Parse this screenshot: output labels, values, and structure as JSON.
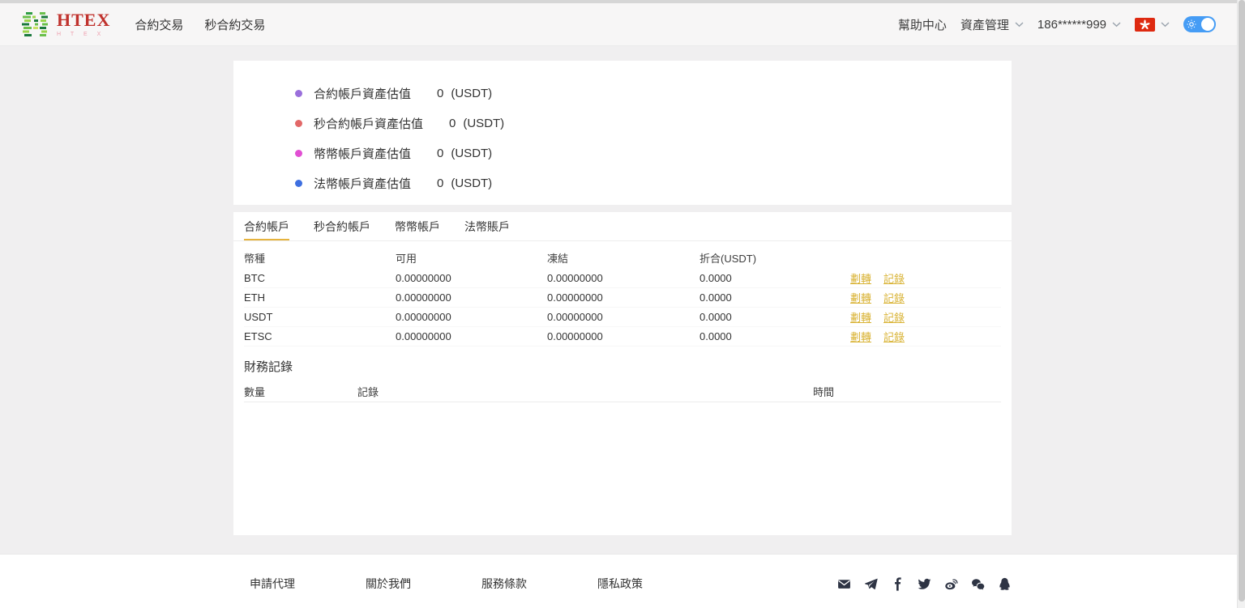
{
  "header": {
    "logo": {
      "title": "HTEX",
      "subtitle": "H T E X"
    },
    "nav": [
      {
        "id": "contract-trading",
        "label": "合約交易"
      },
      {
        "id": "second-contract-trading",
        "label": "秒合約交易"
      }
    ],
    "help_center": "幫助中心",
    "asset_management": "資產管理",
    "account": "186******999",
    "language_flag": "hong-kong",
    "theme_toggle_on": true
  },
  "summary": {
    "items": [
      {
        "label": "合約帳戶資產估值",
        "value": "0",
        "unit": "(USDT)",
        "dot_color": "#9a6fdb"
      },
      {
        "label": "秒合約帳戶資產估值",
        "value": "0",
        "unit": "(USDT)",
        "dot_color": "#e26868"
      },
      {
        "label": "幣幣帳戶資產估值",
        "value": "0",
        "unit": "(USDT)",
        "dot_color": "#e14fd3"
      },
      {
        "label": "法幣帳戶資產估值",
        "value": "0",
        "unit": "(USDT)",
        "dot_color": "#3e6fe0"
      }
    ]
  },
  "accounts": {
    "tabs": [
      {
        "id": "contract",
        "label": "合約帳戶",
        "active": true
      },
      {
        "id": "second-contract",
        "label": "秒合約帳戶",
        "active": false
      },
      {
        "id": "spot",
        "label": "幣幣帳戶",
        "active": false
      },
      {
        "id": "fiat",
        "label": "法幣賬戶",
        "active": false
      }
    ],
    "table": {
      "headers": [
        "幣種",
        "可用",
        "凍結",
        "折合(USDT)"
      ],
      "rows": [
        {
          "coin": "BTC",
          "available": "0.00000000",
          "frozen": "0.00000000",
          "converted": "0.0000"
        },
        {
          "coin": "ETH",
          "available": "0.00000000",
          "frozen": "0.00000000",
          "converted": "0.0000"
        },
        {
          "coin": "USDT",
          "available": "0.00000000",
          "frozen": "0.00000000",
          "converted": "0.0000"
        },
        {
          "coin": "ETSC",
          "available": "0.00000000",
          "frozen": "0.00000000",
          "converted": "0.0000"
        }
      ],
      "actions": {
        "transfer": "劃轉",
        "record": "記錄"
      }
    },
    "records": {
      "title": "財務記錄",
      "headers": [
        "數量",
        "記錄",
        "時間"
      ]
    }
  },
  "footer": {
    "links": [
      {
        "id": "apply-agent",
        "label": "申請代理"
      },
      {
        "id": "about-us",
        "label": "關於我們"
      },
      {
        "id": "terms-of-service",
        "label": "服務條款"
      },
      {
        "id": "privacy-policy",
        "label": "隱私政策"
      }
    ],
    "social_icons": [
      "email-icon",
      "telegram-icon",
      "facebook-icon",
      "twitter-icon",
      "weibo-icon",
      "wechat-icon",
      "qq-icon"
    ]
  },
  "colors": {
    "accent_gold_link": "#d9b335",
    "active_tab_underline": "#e6b33d",
    "social_icon": "#2e3444",
    "flag_red": "#de2910",
    "toggle_blue": "#459cf5",
    "logo_red": "#c0322d"
  }
}
